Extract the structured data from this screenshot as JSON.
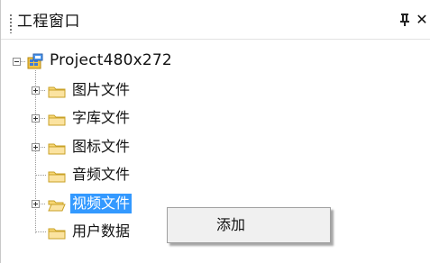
{
  "window": {
    "title": "工程窗口",
    "pin_glyph": "ꝑ",
    "close_glyph": "✕"
  },
  "tree": {
    "root": {
      "label": "Project480x272",
      "icon": "project-icon",
      "expanded": true
    },
    "items": [
      {
        "label": "图片文件",
        "has_children": true,
        "icon": "folder-closed-icon",
        "selected": false
      },
      {
        "label": "字库文件",
        "has_children": true,
        "icon": "folder-closed-icon",
        "selected": false
      },
      {
        "label": "图标文件",
        "has_children": true,
        "icon": "folder-closed-icon",
        "selected": false
      },
      {
        "label": "音频文件",
        "has_children": false,
        "icon": "folder-closed-icon",
        "selected": false
      },
      {
        "label": "视频文件",
        "has_children": true,
        "icon": "folder-open-icon",
        "selected": true
      },
      {
        "label": "用户数据",
        "has_children": false,
        "icon": "folder-closed-icon",
        "selected": false
      }
    ]
  },
  "context_menu": {
    "items": [
      {
        "label": "添加"
      }
    ]
  },
  "colors": {
    "selection": "#3399ff",
    "folder_fill": "#f8d775",
    "folder_edge": "#c9a227"
  }
}
